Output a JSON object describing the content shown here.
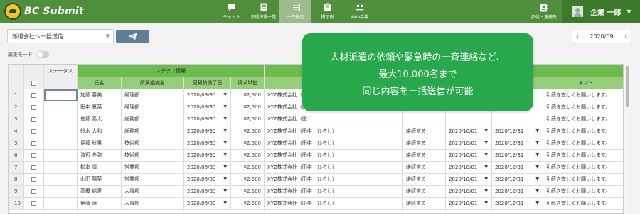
{
  "app": {
    "logo_text": "BC Submit"
  },
  "nav": [
    {
      "label": "チャット",
      "icon": "chat-icon",
      "active": false
    },
    {
      "label": "派遣稼働一覧",
      "icon": "document-list-icon",
      "active": false
    },
    {
      "label": "一斉送信",
      "icon": "broadcast-icon",
      "active": true
    },
    {
      "label": "掲示板",
      "icon": "bulletin-board-icon",
      "active": false
    },
    {
      "label": "Web会議",
      "icon": "web-meeting-icon",
      "active": false
    }
  ],
  "contact": {
    "label": "招待・連絡先",
    "icon": "contact-icon"
  },
  "user": {
    "name": "企業 一郎",
    "caret": "▼"
  },
  "toolbar": {
    "select_value": "派遣会社へ一括送信",
    "select_caret": "▼",
    "edit_mode_label": "編集モード",
    "pager_prev": "‹",
    "pager_value": "2020/09",
    "pager_next": "›"
  },
  "table": {
    "header_status": "ステータス",
    "header_staff_group": "スタッフ情報",
    "header_right_extra": "る ⊙",
    "header_answer_group": "回答",
    "columns": {
      "name": "氏名",
      "dept": "所属組織名",
      "contract_end": "原契約満了日",
      "rate": "請求単価",
      "comment": "コメント"
    },
    "rows": [
      {
        "num": "1",
        "name": "加藤 春美",
        "dept": "経理部",
        "end": "2020/09/30",
        "rate": "¥2,500",
        "company": "XYZ株式会社（田",
        "cont": "",
        "from": "",
        "to": "",
        "comment": "引続き宜しくお願いします。"
      },
      {
        "num": "2",
        "name": "田中 夏菜",
        "dept": "経理部",
        "end": "2020/09/30",
        "rate": "¥2,500",
        "company": "XYZ株式会社（田",
        "cont": "",
        "from": "",
        "to": "",
        "comment": "引続き宜しくお願いします。"
      },
      {
        "num": "3",
        "name": "佐藤 奏太",
        "dept": "総務部",
        "end": "2020/09/30",
        "rate": "¥2,500",
        "company": "XYZ株式会社（田",
        "cont": "",
        "from": "",
        "to": "",
        "comment": "引続き宜しくお願いします。"
      },
      {
        "num": "4",
        "name": "鈴木 大和",
        "dept": "総務部",
        "end": "2020/09/30",
        "rate": "¥2,500",
        "company": "XYZ株式会社（田中　ひろし）",
        "cont": "継続する",
        "from": "2020/10/01",
        "to": "2020/12/31",
        "comment": "引続き宜しくお願いします。"
      },
      {
        "num": "5",
        "name": "伊藤 秋男",
        "dept": "技術部",
        "end": "2020/09/30",
        "rate": "¥2,500",
        "company": "XYZ株式会社（田中　ひろし）",
        "cont": "継続する",
        "from": "2020/10/01",
        "to": "2020/12/31",
        "comment": "引続き宜しくお願いします。"
      },
      {
        "num": "6",
        "name": "渡辺 冬弥",
        "dept": "技術部",
        "end": "2020/09/30",
        "rate": "¥2,500",
        "company": "XYZ株式会社（田中　ひろし）",
        "cont": "継続する",
        "from": "2020/10/01",
        "to": "2020/12/31",
        "comment": "引続き宜しくお願いします。"
      },
      {
        "num": "7",
        "name": "松本 凛",
        "dept": "営業部",
        "end": "2020/09/30",
        "rate": "¥2,500",
        "company": "XYZ株式会社（田中　ひろし）",
        "cont": "継続する",
        "from": "2020/10/01",
        "to": "2020/12/31",
        "comment": "引続き宜しくお願いします。"
      },
      {
        "num": "8",
        "name": "山田 陽葵",
        "dept": "営業部",
        "end": "2020/09/30",
        "rate": "¥2,500",
        "company": "XYZ株式会社（田中　ひろし）",
        "cont": "継続する",
        "from": "2020/10/01",
        "to": "2020/12/31",
        "comment": "引続き宜しくお願いします。"
      },
      {
        "num": "9",
        "name": "高橋 結愛",
        "dept": "人事部",
        "end": "2020/09/30",
        "rate": "¥2,500",
        "company": "XYZ株式会社（田中　ひろし）",
        "cont": "継続する",
        "from": "2020/10/01",
        "to": "2020/12/31",
        "comment": "引続き宜しくお願いします。"
      },
      {
        "num": "10",
        "name": "伊藤 蓮",
        "dept": "人事部",
        "end": "2020/09/30",
        "rate": "¥2,500",
        "company": "XYZ株式会社（田中　ひろし）",
        "cont": "継続する",
        "from": "2020/10/01",
        "to": "2020/12/31",
        "comment": "引続き宜しくお願いします。"
      }
    ]
  },
  "callout": {
    "line1": "人材派遣の依頼や緊急時の一斉連絡など、",
    "line2": "最大10,000名まで",
    "line3": "同じ内容を一括送信が可能"
  },
  "colors": {
    "topbar": "#4f8e3a",
    "callout": "#27a84a",
    "header_green": "#6dbc4e",
    "send_button": "#5f7f96"
  }
}
